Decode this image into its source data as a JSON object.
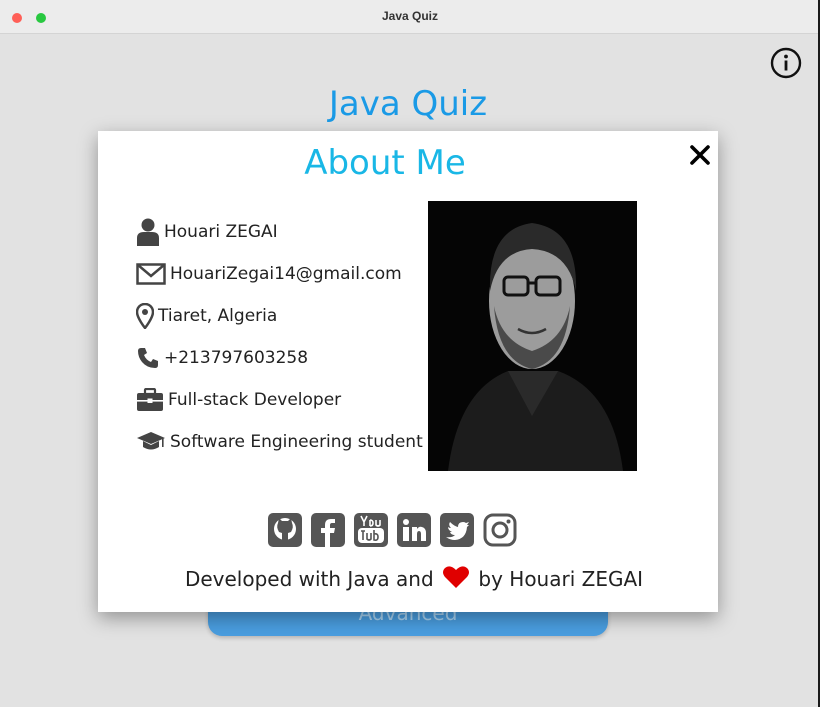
{
  "window": {
    "title": "Java Quiz"
  },
  "app": {
    "title": "Java Quiz",
    "advanced_button": "Advanced"
  },
  "dialog": {
    "title": "About Me",
    "name": "Houari ZEGAI",
    "email": "HouariZegai14@gmail.com",
    "location": "Tiaret, Algeria",
    "phone": "+213797603258",
    "job": "Full-stack Developer",
    "education": "Software Engineering student",
    "socials": [
      "github-icon",
      "facebook-icon",
      "youtube-icon",
      "linkedin-icon",
      "twitter-icon",
      "instagram-icon"
    ],
    "footer": {
      "prefix": "Developed with Java and",
      "suffix": "by Houari ZEGAI"
    }
  },
  "colors": {
    "title_blue": "#1a9ae6",
    "dialog_title": "#19b7e6",
    "heart": "#e00000",
    "icon_gray": "#555555"
  }
}
